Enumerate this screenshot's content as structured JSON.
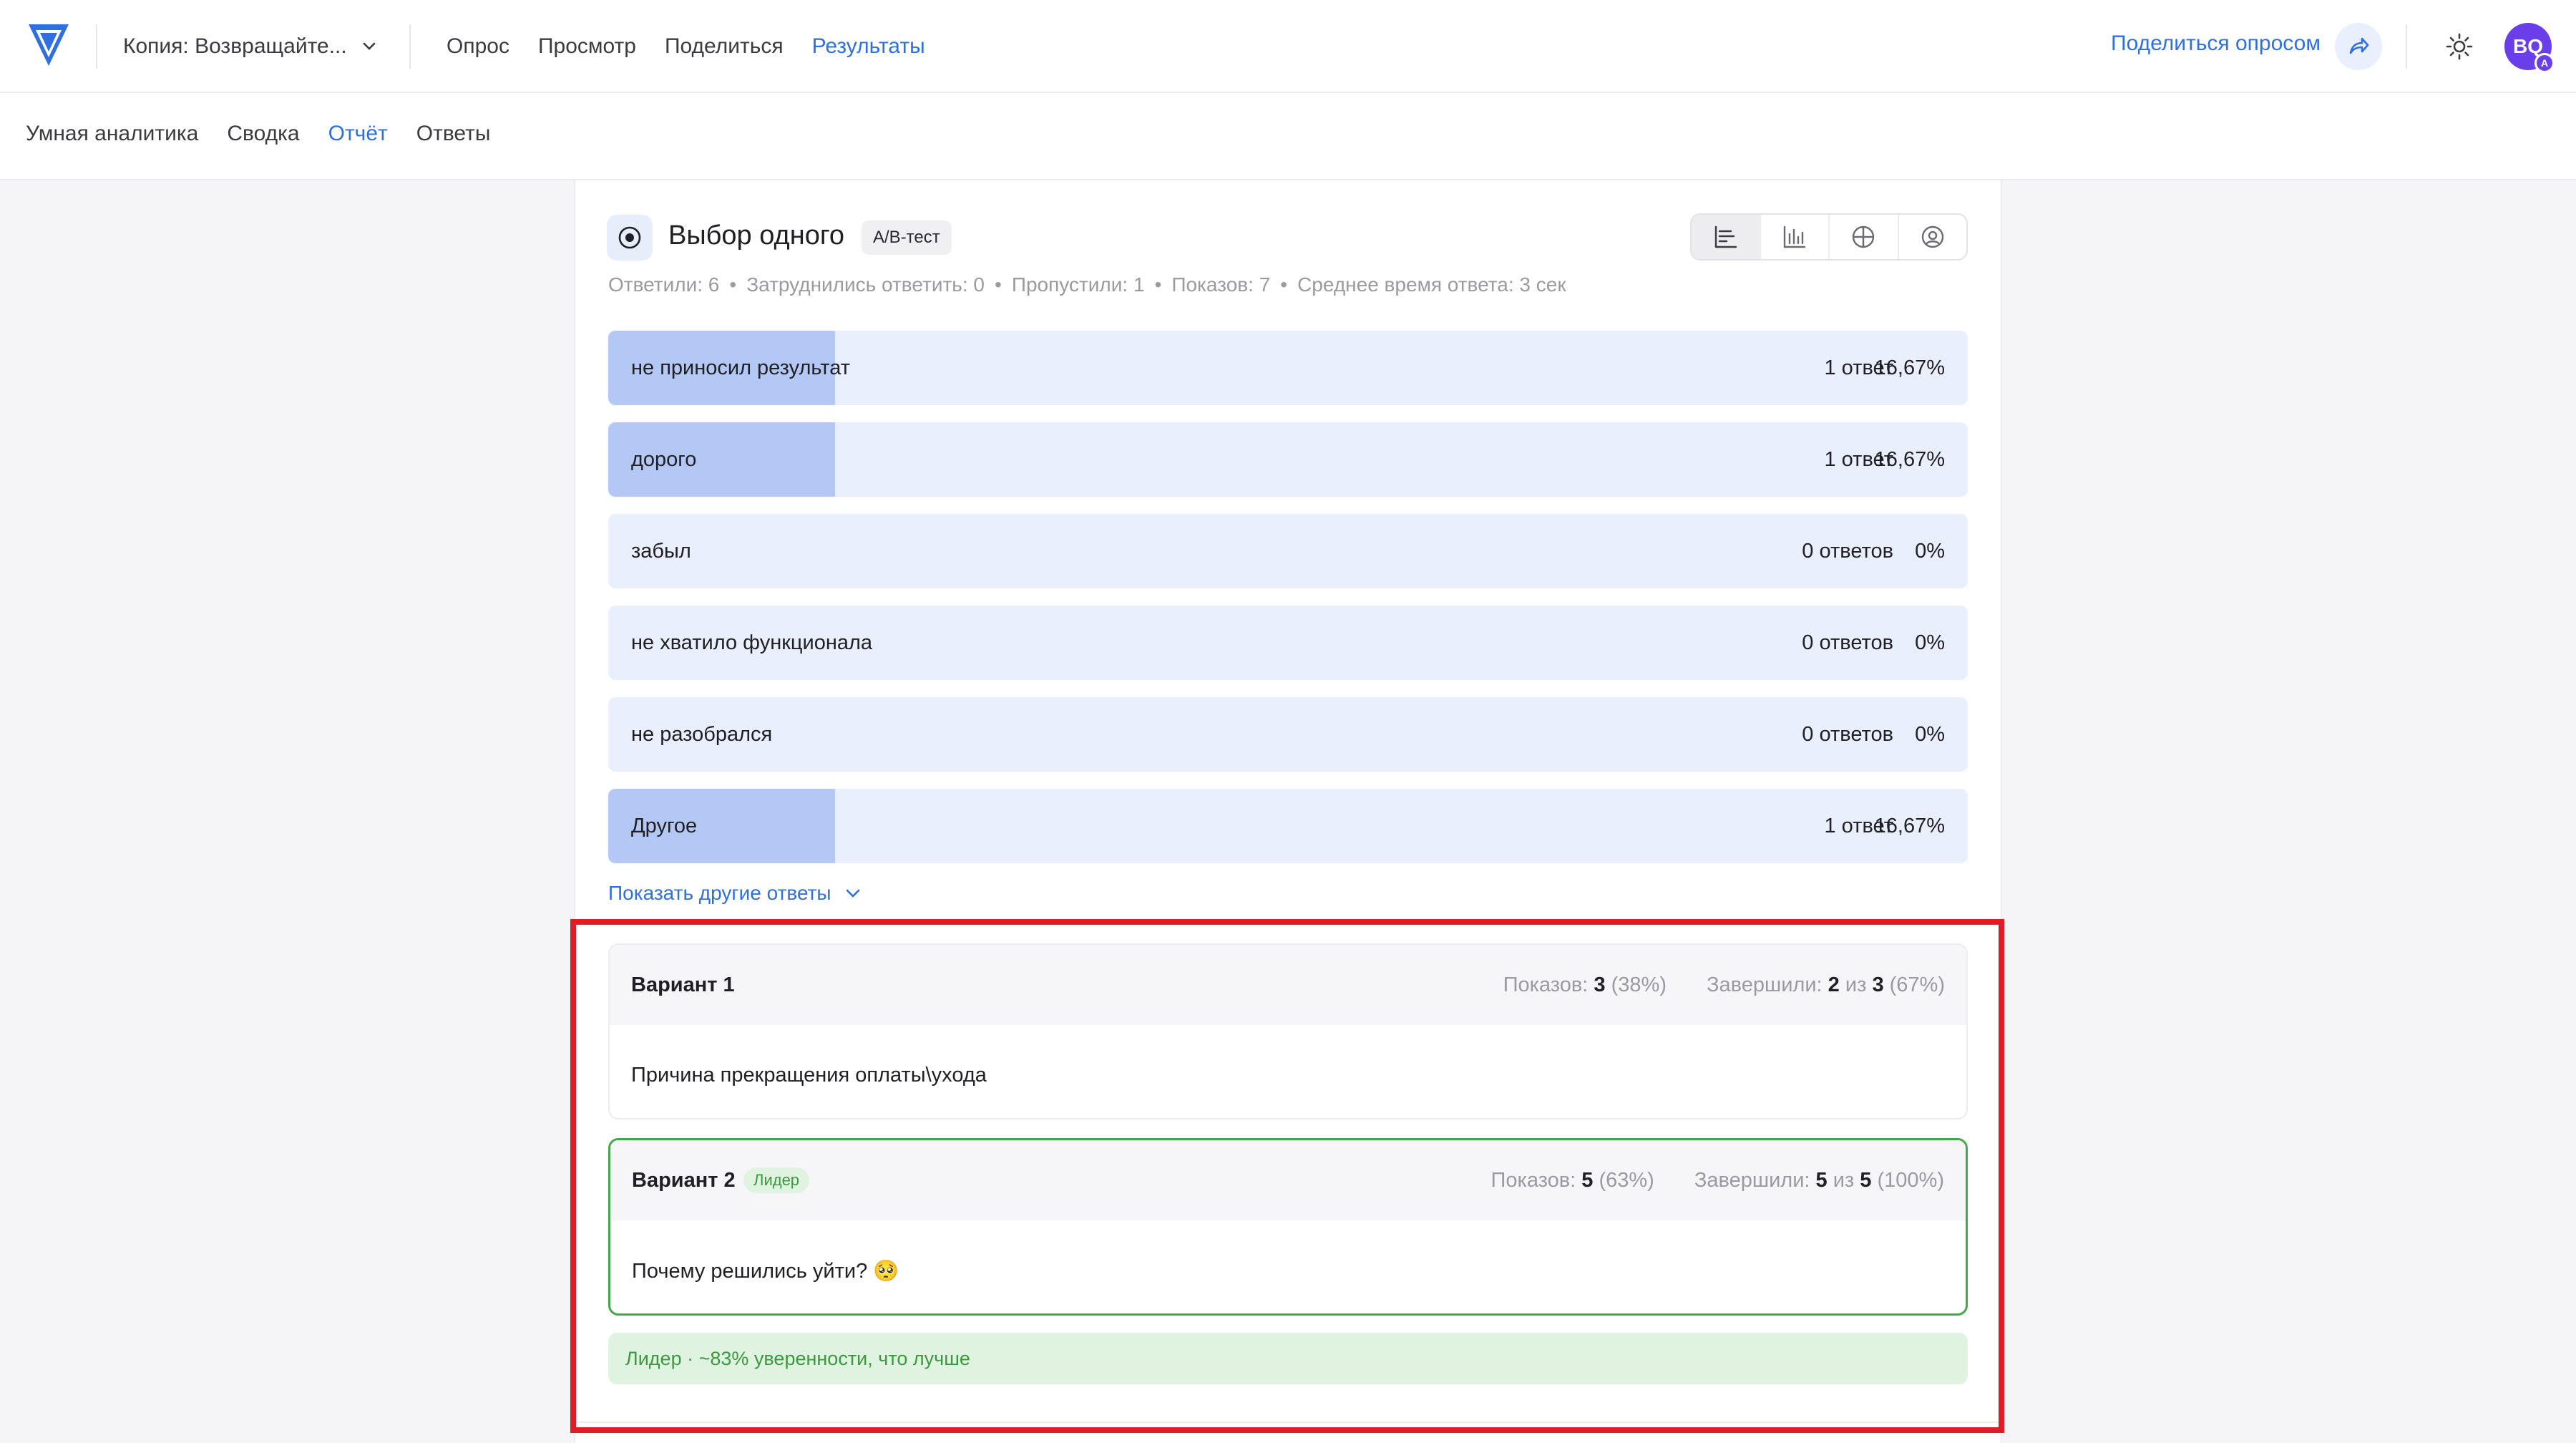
{
  "header": {
    "survey_name": "Копия: Возвращайте...",
    "nav": [
      "Опрос",
      "Просмотр",
      "Поделиться",
      "Результаты"
    ],
    "nav_active": 3,
    "share_label": "Поделиться опросом",
    "avatar_initials": "BQ",
    "avatar_badge": "A",
    "brand_color": "#2f6fe0"
  },
  "subnav": {
    "items": [
      "Умная аналитика",
      "Сводка",
      "Отчёт",
      "Ответы"
    ],
    "active": 2
  },
  "question": {
    "title": "Выбор одного",
    "badge": "A/B-тест",
    "stats": [
      "Ответили: 6",
      "Затруднились ответить: 0",
      "Пропустили: 1",
      "Показов: 7",
      "Среднее время ответа: 3 сек"
    ],
    "options": [
      {
        "label": "не приносил результат",
        "count": "1 ответ",
        "percent": "16,67%",
        "fraction": 0.1667
      },
      {
        "label": "дорого",
        "count": "1 ответ",
        "percent": "16,67%",
        "fraction": 0.1667
      },
      {
        "label": "забыл",
        "count": "0 ответов",
        "percent": "0%",
        "fraction": 0
      },
      {
        "label": "не хватило функционала",
        "count": "0 ответов",
        "percent": "0%",
        "fraction": 0
      },
      {
        "label": "не разобрался",
        "count": "0 ответов",
        "percent": "0%",
        "fraction": 0
      },
      {
        "label": "Другое",
        "count": "1 ответ",
        "percent": "16,67%",
        "fraction": 0.1667
      }
    ],
    "show_more": "Показать другие ответы"
  },
  "variants": [
    {
      "name": "Вариант 1",
      "shows_label": "Показов:",
      "shows": "3",
      "shows_pct": "(38%)",
      "done_label": "Завершили:",
      "done": "2",
      "of": "из",
      "total": "3",
      "done_pct": "(67%)",
      "text": "Причина прекращения оплаты\\ухода"
    },
    {
      "name": "Вариант 2",
      "tag": "Лидер",
      "shows_label": "Показов:",
      "shows": "5",
      "shows_pct": "(63%)",
      "done_label": "Завершили:",
      "done": "5",
      "of": "из",
      "total": "5",
      "done_pct": "(100%)",
      "text": "Почему решились уйти? 🥺"
    }
  ],
  "leader_note": "Лидер · ~83% уверенности, что лучше"
}
